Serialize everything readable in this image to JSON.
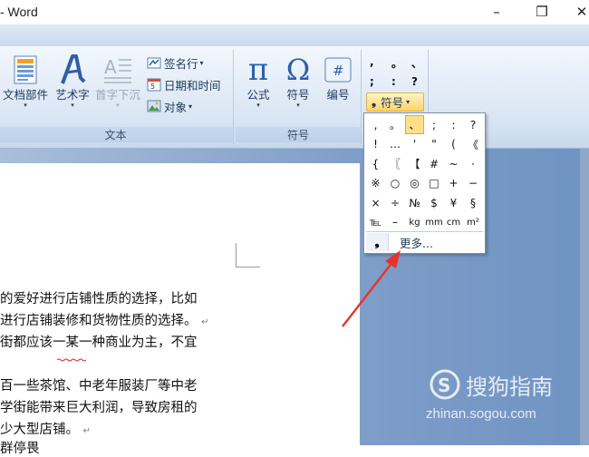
{
  "window": {
    "title": "- Word",
    "minimize_glyph": "–",
    "restore_glyph": "❐",
    "close_glyph": "✕"
  },
  "ribbon": {
    "text_group": {
      "label": "文本",
      "buttons": {
        "quick_parts": "文档部件",
        "wordart": "艺术字",
        "drop_cap": "首字下沉"
      },
      "small_buttons": {
        "signature_line": "签名行",
        "date_time": "日期和时间",
        "object": "对象"
      }
    },
    "symbols_group": {
      "label": "符号",
      "buttons": {
        "equation": "公式",
        "symbol": "符号",
        "number": "编号"
      }
    },
    "mini_symbols": [
      ",",
      "。",
      "、",
      ";",
      ":",
      "?"
    ],
    "symbol_dropdown_label": "符号",
    "caret": "▾"
  },
  "symbol_popup": {
    "rows": [
      [
        ",",
        "。",
        "、",
        ";",
        ":",
        "?"
      ],
      [
        "!",
        "…",
        "'",
        "\"",
        "(",
        "《"
      ],
      [
        "{",
        "〖",
        "【",
        "#",
        "~",
        "·"
      ],
      [
        "※",
        "○",
        "◎",
        "□",
        "+",
        "−"
      ],
      [
        "×",
        "÷",
        "№",
        "$",
        "¥",
        "§"
      ],
      [
        "℡",
        "–",
        "kg",
        "mm",
        "cm",
        "m²"
      ]
    ],
    "selected": "、",
    "more_icon": "❟",
    "more_label": "更多..."
  },
  "document": {
    "lines": [
      "的爱好进行店铺性质的选择，比如",
      "进行店铺装修和货物性质的选择。",
      "街都应该一某一种商业为主，不宜",
      "",
      "百一些茶馆、中老年服装厂等中老",
      "学街能带来巨大利润，导致房租的",
      "少大型店铺。",
      "群停畏"
    ],
    "paragraph_mark": "↵"
  },
  "watermark": {
    "brand": "搜狗指南",
    "url": "zhinan.sogou.com"
  },
  "colors": {
    "ribbon_text": "#1e395b",
    "highlight": "#ffe08a",
    "arrow": "#e8332a",
    "doc_background": "#7f9ec8"
  }
}
